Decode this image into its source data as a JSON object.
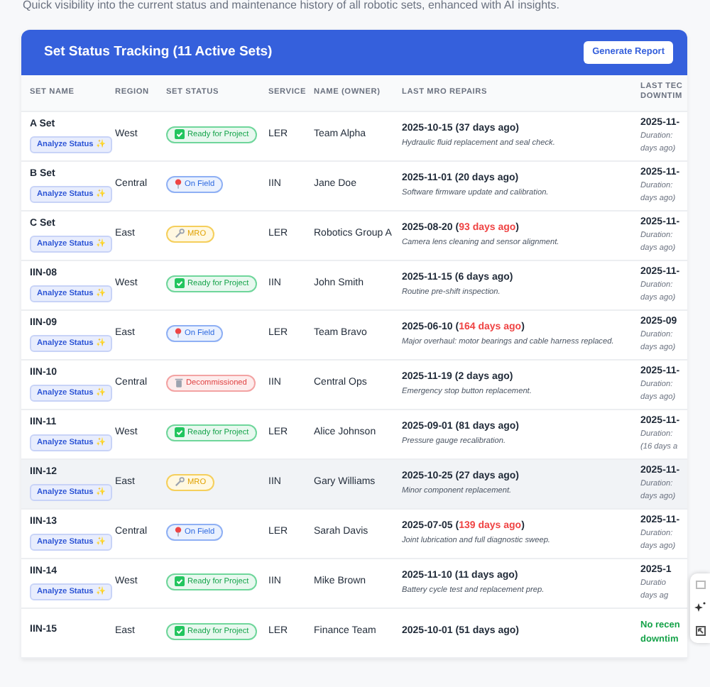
{
  "subtitle": "Quick visibility into the current status and maintenance history of all robotic sets, enhanced with AI insights.",
  "card": {
    "title": "Set Status Tracking (11 Active Sets)",
    "action": "Generate Report"
  },
  "table": {
    "columns": [
      "SET NAME",
      "REGION",
      "SET STATUS",
      "SERVICE",
      "NAME (OWNER)",
      "LAST MRO REPAIRS",
      [
        "LAST TEC",
        "DOWNTIM"
      ]
    ],
    "rows": [
      {
        "name": "A Set",
        "analyze": "Analyze Status ✨",
        "region": "West",
        "status": {
          "kind": "ready",
          "label": "Ready for Project"
        },
        "service": "LER",
        "owner": "Team Alpha",
        "repair": {
          "date": "2025-10-15 (",
          "ago": "37 days ago",
          "tail": ")",
          "overdue": false,
          "note": "Hydraulic fluid replacement and seal check."
        },
        "downtime": {
          "kind": "record",
          "lines": [
            "2025-11-",
            "Duration:",
            "days ago)"
          ]
        },
        "selected": false
      },
      {
        "name": "B Set",
        "analyze": "Analyze Status ✨",
        "region": "Central",
        "status": {
          "kind": "field",
          "label": "On Field"
        },
        "service": "IIN",
        "owner": "Jane Doe",
        "repair": {
          "date": "2025-11-01 (",
          "ago": "20 days ago",
          "tail": ")",
          "overdue": false,
          "note": "Software firmware update and calibration."
        },
        "downtime": {
          "kind": "record",
          "lines": [
            "2025-11-",
            "Duration:",
            "days ago)"
          ]
        },
        "selected": false
      },
      {
        "name": "C Set",
        "analyze": "Analyze Status ✨",
        "region": "East",
        "status": {
          "kind": "mro",
          "label": "MRO"
        },
        "service": "LER",
        "owner": "Robotics Group A",
        "repair": {
          "date": "2025-08-20 (",
          "ago": "93 days ago",
          "tail": ")",
          "overdue": true,
          "note": "Camera lens cleaning and sensor alignment."
        },
        "downtime": {
          "kind": "record",
          "lines": [
            "2025-11-",
            "Duration:",
            "days ago)"
          ]
        },
        "selected": false
      },
      {
        "name": "IIN-08",
        "analyze": "Analyze Status ✨",
        "region": "West",
        "status": {
          "kind": "ready",
          "label": "Ready for Project"
        },
        "service": "IIN",
        "owner": "John Smith",
        "repair": {
          "date": "2025-11-15 (",
          "ago": "6 days ago",
          "tail": ")",
          "overdue": false,
          "note": "Routine pre-shift inspection."
        },
        "downtime": {
          "kind": "record",
          "lines": [
            "2025-11-",
            "Duration:",
            "days ago)"
          ]
        },
        "selected": false
      },
      {
        "name": "IIN-09",
        "analyze": "Analyze Status ✨",
        "region": "East",
        "status": {
          "kind": "field",
          "label": "On Field"
        },
        "service": "LER",
        "owner": "Team Bravo",
        "repair": {
          "date": "2025-06-10 (",
          "ago": "164 days ago",
          "tail": ")",
          "overdue": true,
          "note": "Major overhaul: motor bearings and cable harness replaced."
        },
        "downtime": {
          "kind": "record",
          "lines": [
            "2025-09",
            "Duration:",
            "days ago)"
          ]
        },
        "selected": false
      },
      {
        "name": "IIN-10",
        "analyze": "Analyze Status ✨",
        "region": "Central",
        "status": {
          "kind": "decommissioned",
          "label": "Decommissioned"
        },
        "service": "IIN",
        "owner": "Central Ops",
        "repair": {
          "date": "2025-11-19 (",
          "ago": "2 days ago",
          "tail": ")",
          "overdue": false,
          "note": "Emergency stop button replacement."
        },
        "downtime": {
          "kind": "record",
          "lines": [
            "2025-11-",
            "Duration:",
            "days ago)"
          ]
        },
        "selected": false
      },
      {
        "name": "IIN-11",
        "analyze": "Analyze Status ✨",
        "region": "West",
        "status": {
          "kind": "ready",
          "label": "Ready for Project"
        },
        "service": "LER",
        "owner": "Alice Johnson",
        "repair": {
          "date": "2025-09-01 (",
          "ago": "81 days ago",
          "tail": ")",
          "overdue": false,
          "note": "Pressure gauge recalibration."
        },
        "downtime": {
          "kind": "record",
          "lines": [
            "2025-11-",
            "Duration:",
            "(16 days a"
          ]
        },
        "selected": false
      },
      {
        "name": "IIN-12",
        "analyze": "Analyze Status ✨",
        "region": "East",
        "status": {
          "kind": "mro",
          "label": "MRO"
        },
        "service": "IIN",
        "owner": "Gary Williams",
        "repair": {
          "date": "2025-10-25 (",
          "ago": "27 days ago",
          "tail": ")",
          "overdue": false,
          "note": "Minor component replacement."
        },
        "downtime": {
          "kind": "record",
          "lines": [
            "2025-11-",
            "Duration:",
            "days ago)"
          ]
        },
        "selected": true
      },
      {
        "name": "IIN-13",
        "analyze": "Analyze Status ✨",
        "region": "Central",
        "status": {
          "kind": "field",
          "label": "On Field"
        },
        "service": "LER",
        "owner": "Sarah Davis",
        "repair": {
          "date": "2025-07-05 (",
          "ago": "139 days ago",
          "tail": ")",
          "overdue": true,
          "note": "Joint lubrication and full diagnostic sweep."
        },
        "downtime": {
          "kind": "record",
          "lines": [
            "2025-11-",
            "Duration:",
            "days ago)"
          ]
        },
        "selected": false
      },
      {
        "name": "IIN-14",
        "analyze": "Analyze Status ✨",
        "region": "West",
        "status": {
          "kind": "ready",
          "label": "Ready for Project"
        },
        "service": "IIN",
        "owner": "Mike Brown",
        "repair": {
          "date": "2025-11-10 (",
          "ago": "11 days ago",
          "tail": ")",
          "overdue": false,
          "note": "Battery cycle test and replacement prep."
        },
        "downtime": {
          "kind": "record",
          "lines": [
            "2025-1",
            "Duratio",
            "days ag"
          ]
        },
        "selected": false
      },
      {
        "name": "IIN-15",
        "region": "East",
        "status": {
          "kind": "ready",
          "label": "Ready for Project"
        },
        "service": "LER",
        "owner": "Finance Team",
        "repair": {
          "date": "2025-10-01 (",
          "ago": "51 days ago",
          "tail": ")",
          "overdue": false
        },
        "downtime": {
          "kind": "none",
          "lines": [
            "No recen",
            "downtim"
          ]
        },
        "selected": false
      }
    ]
  }
}
